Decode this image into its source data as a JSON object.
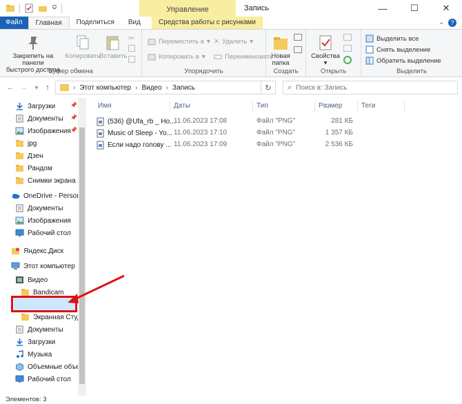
{
  "window": {
    "title": "Запись",
    "context_header": "Управление",
    "controls": {
      "minimize": "—",
      "maximize": "☐",
      "close": "✕"
    }
  },
  "tabs": [
    {
      "label": "Файл"
    },
    {
      "label": "Главная"
    },
    {
      "label": "Поделиться"
    },
    {
      "label": "Вид"
    },
    {
      "label": "Средства работы с рисунками"
    }
  ],
  "ribbon": {
    "clipboard": {
      "pin": "Закрепить на панели быстрого доступа",
      "pin_line1": "Закрепить на панели",
      "pin_line2": "быстрого доступа",
      "copy": "Копировать",
      "paste": "Вставить",
      "label": "Буфер обмена"
    },
    "organize": {
      "move_to": "Переместить в",
      "copy_to": "Копировать в",
      "delete": "Удалить",
      "rename": "Переименовать",
      "label": "Упорядочить"
    },
    "create": {
      "new_folder_line1": "Новая",
      "new_folder_line2": "папка",
      "label": "Создать"
    },
    "open": {
      "properties": "Свойства",
      "label": "Открыть"
    },
    "select": {
      "select_all": "Выделить все",
      "select_none": "Снять выделение",
      "invert": "Обратить выделение",
      "label": "Выделить"
    }
  },
  "address": {
    "crumbs": [
      "Этот компьютер",
      "Видео",
      "Запись"
    ],
    "search_placeholder": "Поиск в: Запись"
  },
  "navpane": {
    "items": [
      {
        "label": "Загрузки",
        "icon": "download-icon",
        "pinned": true
      },
      {
        "label": "Документы",
        "icon": "documents-icon",
        "pinned": true
      },
      {
        "label": "Изображения",
        "icon": "pictures-icon",
        "pinned": true
      },
      {
        "label": "jpg",
        "icon": "folder-icon",
        "pinned": false
      },
      {
        "label": "Дзен",
        "icon": "folder-icon",
        "pinned": false
      },
      {
        "label": "Рандом",
        "icon": "folder-icon",
        "pinned": false
      },
      {
        "label": "Снимки экрана",
        "icon": "folder-icon",
        "pinned": false
      },
      {
        "label": "OneDrive - Personal",
        "icon": "cloud-icon",
        "pinned": false
      },
      {
        "label": "Документы",
        "icon": "documents-icon",
        "pinned": false
      },
      {
        "label": "Изображения",
        "icon": "pictures-icon",
        "pinned": false
      },
      {
        "label": "Рабочий стол",
        "icon": "desktop-icon",
        "pinned": false
      },
      {
        "label": "Яндекс.Диск",
        "icon": "yandex-disk-icon",
        "pinned": false
      },
      {
        "label": "Этот компьютер",
        "icon": "computer-icon",
        "pinned": false
      },
      {
        "label": "Видео",
        "icon": "video-icon",
        "pinned": false
      },
      {
        "label": "Bandicam",
        "icon": "folder-icon",
        "pinned": false
      },
      {
        "label": "Запись",
        "icon": "folder-icon",
        "pinned": false
      },
      {
        "label": "Экранная Студи",
        "icon": "folder-icon",
        "pinned": false
      },
      {
        "label": "Документы",
        "icon": "documents-icon",
        "pinned": false
      },
      {
        "label": "Загрузки",
        "icon": "download-icon",
        "pinned": false
      },
      {
        "label": "Музыка",
        "icon": "music-icon",
        "pinned": false
      },
      {
        "label": "Объемные объек",
        "icon": "3d-objects-icon",
        "pinned": false
      },
      {
        "label": "Рабочий стол",
        "icon": "desktop-icon",
        "pinned": false
      }
    ]
  },
  "filelist": {
    "columns": [
      "Имя",
      "Даты",
      "Тип",
      "Размер",
      "Теги"
    ],
    "rows": [
      {
        "name": "(536) @Ufa_rb _ Ho...",
        "date": "11.06.2023 17:08",
        "type": "Файл \"PNG\"",
        "size": "281 КБ"
      },
      {
        "name": "Music of Sleep - Yo...",
        "date": "11.06.2023 17:10",
        "type": "Файл \"PNG\"",
        "size": "1 357 КБ"
      },
      {
        "name": "Если надо голову ...",
        "date": "11.06.2023 17:09",
        "type": "Файл \"PNG\"",
        "size": "2 536 КБ"
      }
    ]
  },
  "status": {
    "items_count": "Элементов: 3"
  },
  "colors": {
    "file_tab": "#1a63b8",
    "context_tab": "#f8eda1",
    "highlight": "#e01010",
    "folder": "#f5c95c"
  }
}
